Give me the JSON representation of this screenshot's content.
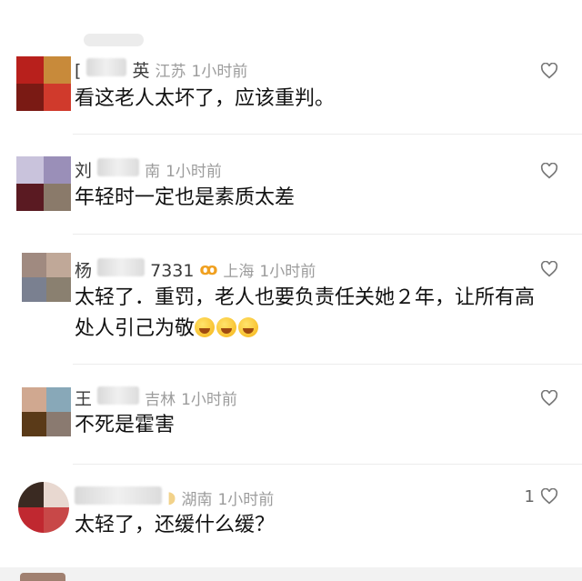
{
  "comments": [
    {
      "name_start": "[",
      "name_end": "英",
      "location": "江苏",
      "time": "1小时前",
      "text": "看这老人太坏了，应该重判。",
      "likes": "",
      "avatar_colors": [
        "#b8201c",
        "#c88a3a",
        "#7a1a14",
        "#d03a2c"
      ]
    },
    {
      "name_start": "刘",
      "name_end": "南",
      "location": "",
      "time": "1小时前",
      "text": "年轻时一定也是素质太差",
      "likes": "",
      "avatar_colors": [
        "#c9c3dc",
        "#9a8fb8",
        "#5a1a22",
        "#8a7a6a"
      ]
    },
    {
      "name_start": "杨",
      "name_end": "7331",
      "location": "上海",
      "time": "1小时前",
      "text": "太轻了．重罚，老人也要负责任关她２年，让所有高处人引己为敬",
      "likes": "",
      "avatar_colors": [
        "#a08a80",
        "#c0a898",
        "#7a8090",
        "#8a8070"
      ]
    },
    {
      "name_start": "王",
      "name_end": "吉林",
      "location": "",
      "time": "1小时前",
      "text": "不死是霍害",
      "likes": "",
      "avatar_colors": [
        "#d0a890",
        "#88a8b8",
        "#5a3a18",
        "#8a7a70"
      ]
    },
    {
      "name_start": "",
      "name_end": "",
      "location": "湖南",
      "time": "1小时前",
      "text": "太轻了，还缓什么缓？",
      "likes": "1",
      "avatar_colors": [
        "#3a2a22",
        "#e8d8d0",
        "#c02830",
        "#c84848"
      ]
    }
  ],
  "icons": {
    "like": "heart-outline-icon",
    "vip": "vip-badge-icon",
    "emoji": "laughing-crying-emoji"
  }
}
